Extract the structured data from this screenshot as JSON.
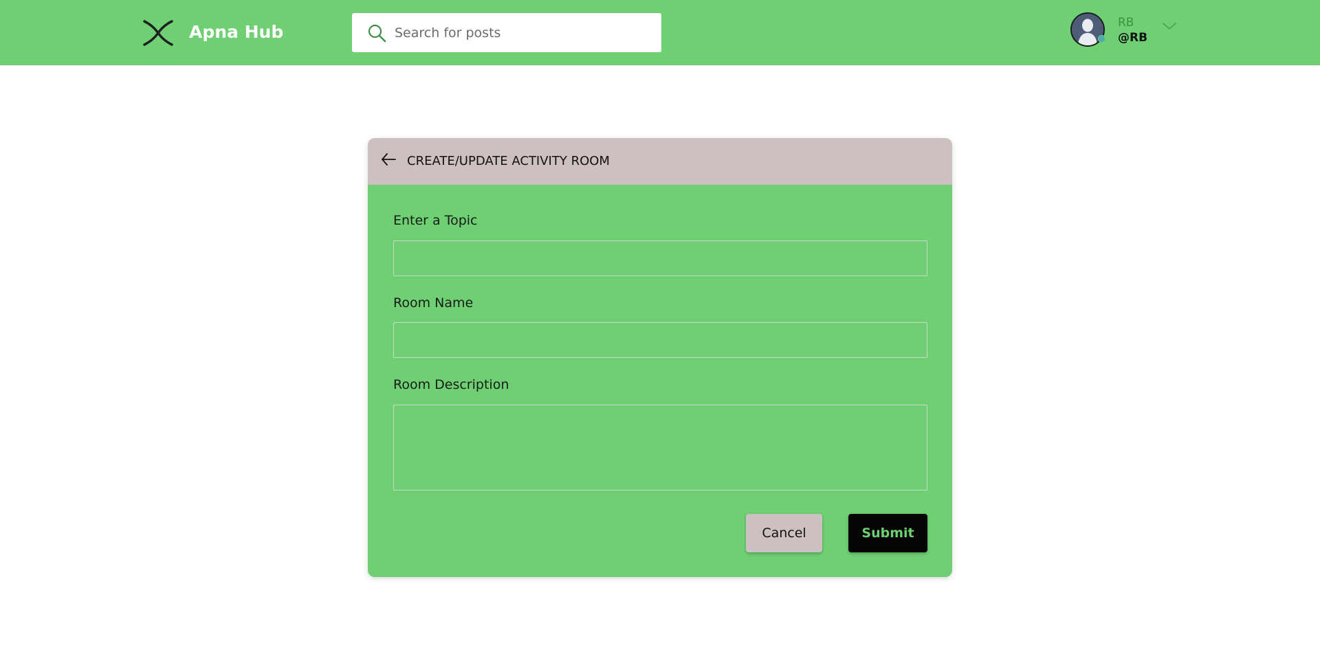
{
  "header": {
    "brand": "Apna Hub",
    "search": {
      "placeholder": "Search for posts",
      "value": ""
    },
    "user": {
      "name": "RB",
      "handle": "@RB"
    }
  },
  "form": {
    "title": "CREATE/UPDATE ACTIVITY ROOM",
    "fields": [
      {
        "label": "Enter a Topic",
        "value": ""
      },
      {
        "label": "Room Name",
        "value": ""
      },
      {
        "label": "Room Description",
        "value": ""
      }
    ],
    "cancel_label": "Cancel",
    "submit_label": "Submit"
  },
  "colors": {
    "primary_green": "#6ed073",
    "header_card_bg": "#cdc0c0",
    "submit_bg": "#050505"
  },
  "icons": [
    "app-logo-icon",
    "search-icon",
    "avatar-icon",
    "chevron-down-icon",
    "back-arrow-icon"
  ]
}
